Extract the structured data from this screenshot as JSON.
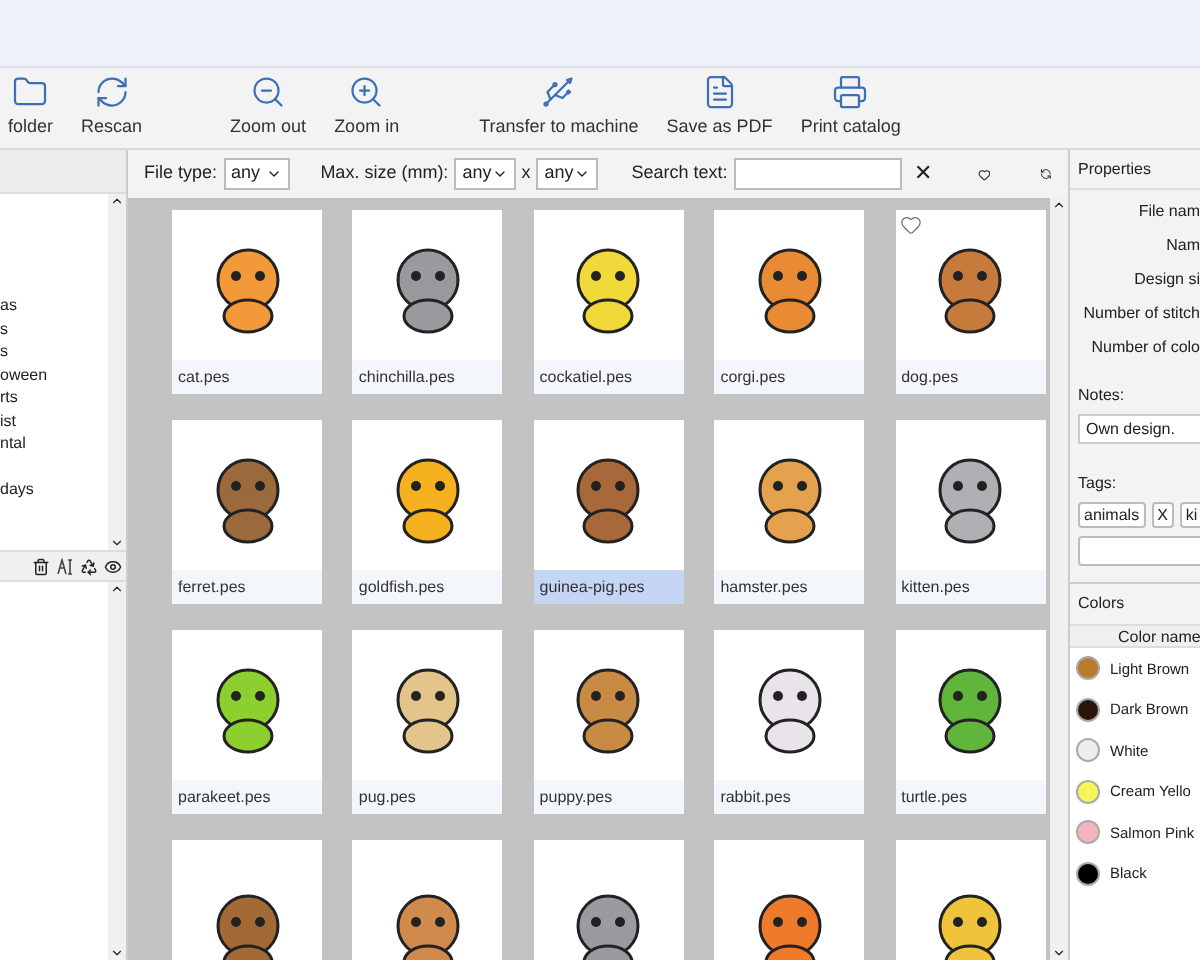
{
  "toolbar": [
    {
      "label": "folder"
    },
    {
      "label": "Rescan"
    },
    {
      "label": "Zoom out"
    },
    {
      "label": "Zoom in"
    },
    {
      "label": "Transfer to machine"
    },
    {
      "label": "Save as PDF"
    },
    {
      "label": "Print catalog"
    }
  ],
  "folders": {
    "items": [
      "as",
      "s",
      "s",
      "oween",
      "rts",
      "ist",
      "ntal",
      "days"
    ]
  },
  "filters": {
    "file_type_label": "File type:",
    "file_type": "any",
    "max_size_label": "Max. size (mm):",
    "max_w": "any",
    "times": "x",
    "max_h": "any",
    "search_label": "Search text:",
    "clear": "✕"
  },
  "designs": [
    {
      "name": "cat.pes",
      "color": "#f29a3a",
      "selected": false,
      "favorite": false
    },
    {
      "name": "chinchilla.pes",
      "color": "#9a9a9e",
      "selected": false,
      "favorite": false
    },
    {
      "name": "cockatiel.pes",
      "color": "#f2d93a",
      "selected": false,
      "favorite": false
    },
    {
      "name": "corgi.pes",
      "color": "#e98a34",
      "selected": false,
      "favorite": false
    },
    {
      "name": "dog.pes",
      "color": "#c67a3c",
      "selected": false,
      "favorite": true
    },
    {
      "name": "ferret.pes",
      "color": "#9b6a3c",
      "selected": false,
      "favorite": false
    },
    {
      "name": "goldfish.pes",
      "color": "#f5b120",
      "selected": false,
      "favorite": false
    },
    {
      "name": "guinea-pig.pes",
      "color": "#a8683a",
      "selected": true,
      "favorite": false
    },
    {
      "name": "hamster.pes",
      "color": "#e5a24e",
      "selected": false,
      "favorite": false
    },
    {
      "name": "kitten.pes",
      "color": "#b0b0b4",
      "selected": false,
      "favorite": false
    },
    {
      "name": "parakeet.pes",
      "color": "#8ccf2e",
      "selected": false,
      "favorite": false
    },
    {
      "name": "pug.pes",
      "color": "#e3c58c",
      "selected": false,
      "favorite": false
    },
    {
      "name": "puppy.pes",
      "color": "#c98a44",
      "selected": false,
      "favorite": false
    },
    {
      "name": "rabbit.pes",
      "color": "#e8e4ea",
      "selected": false,
      "favorite": false
    },
    {
      "name": "turtle.pes",
      "color": "#5fb63a",
      "selected": false,
      "favorite": false
    },
    {
      "color": "#a46a36"
    },
    {
      "color": "#d08a4c"
    },
    {
      "color": "#9a9aa0"
    },
    {
      "color": "#ef7a2a"
    },
    {
      "color": "#f0c43a"
    }
  ],
  "properties": {
    "title": "Properties",
    "fields": [
      "File nam",
      "Nam",
      "Design si",
      "Number of stitch",
      "Number of colo"
    ],
    "notes_label": "Notes:",
    "notes": "Own design.",
    "tags_label": "Tags:",
    "tags": [
      {
        "label": "animals",
        "remove": "X"
      },
      {
        "label": "ki"
      }
    ]
  },
  "colors": {
    "title": "Colors",
    "column": "Color name",
    "rows": [
      {
        "name": "Light Brown",
        "color": "#b97a2a"
      },
      {
        "name": "Dark Brown",
        "color": "#2a1608"
      },
      {
        "name": "White",
        "color": "#eeeeee"
      },
      {
        "name": "Cream Yello",
        "color": "#f7f55a"
      },
      {
        "name": "Salmon Pink",
        "color": "#f6b3c0"
      },
      {
        "name": "Black",
        "color": "#000000"
      }
    ]
  }
}
